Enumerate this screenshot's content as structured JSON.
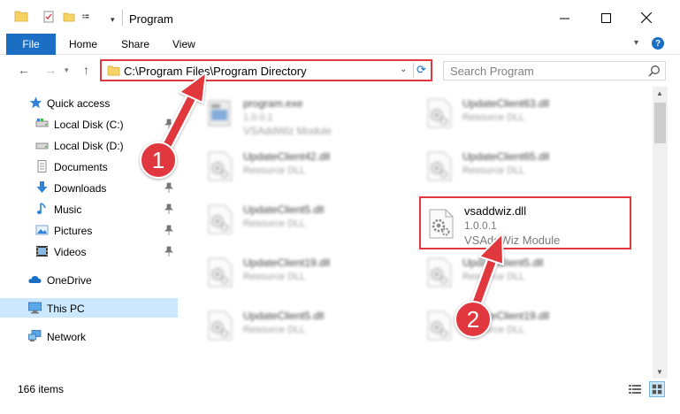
{
  "window": {
    "title": "Program"
  },
  "ribbon": {
    "tabs": [
      {
        "label": "File"
      },
      {
        "label": "Home"
      },
      {
        "label": "Share"
      },
      {
        "label": "View"
      }
    ],
    "help_label": "?"
  },
  "address": {
    "path": "C:\\Program Files\\Program Directory",
    "search_placeholder": "Search Program"
  },
  "sidebar": {
    "items": [
      {
        "label": "Quick access",
        "icon": "star-icon",
        "pinned": false
      },
      {
        "label": "Local Disk (C:)",
        "icon": "drive-icon",
        "pinned": true
      },
      {
        "label": "Local Disk (D:)",
        "icon": "drive-icon",
        "pinned": true
      },
      {
        "label": "Documents",
        "icon": "documents-icon",
        "pinned": true
      },
      {
        "label": "Downloads",
        "icon": "download-icon",
        "pinned": true
      },
      {
        "label": "Music",
        "icon": "music-icon",
        "pinned": true
      },
      {
        "label": "Pictures",
        "icon": "pictures-icon",
        "pinned": true
      },
      {
        "label": "Videos",
        "icon": "videos-icon",
        "pinned": true
      },
      {
        "label": "OneDrive",
        "icon": "cloud-icon",
        "pinned": false
      },
      {
        "label": "This PC",
        "icon": "computer-icon",
        "pinned": false,
        "selected": true
      },
      {
        "label": "Network",
        "icon": "network-icon",
        "pinned": false
      }
    ]
  },
  "files": [
    {
      "name": "program.exe",
      "line2": "1.0.0.1",
      "line3": "VSAddWiz Module",
      "icon": "exe-icon"
    },
    {
      "name": "UpdateClient63.dll",
      "line2": "Resource DLL",
      "line3": "",
      "icon": "dll-gear-icon"
    },
    {
      "name": "UpdateClient42.dll",
      "line2": "Resource DLL",
      "line3": "",
      "icon": "dll-gear-icon"
    },
    {
      "name": "UpdateClient65.dll",
      "line2": "Resource DLL",
      "line3": "",
      "icon": "dll-gear-icon"
    },
    {
      "name": "UpdateClient5.dll",
      "line2": "Resource DLL",
      "line3": "",
      "icon": "dll-gear-icon"
    },
    {
      "name": "vsaddwiz.dll",
      "line2": "1.0.0.1",
      "line3": "VSAddWiz Module",
      "icon": "dll-gear-icon",
      "highlighted": true
    },
    {
      "name": "UpdateClient19.dll",
      "line2": "Resource DLL",
      "line3": "",
      "icon": "dll-gear-icon"
    },
    {
      "name": "UpdateClient5.dll",
      "line2": "Resource DLL",
      "line3": "",
      "icon": "dll-gear-icon"
    },
    {
      "name": "UpdateClient5.dll",
      "line2": "Resource DLL",
      "line3": "",
      "icon": "dll-gear-icon"
    },
    {
      "name": "UpdateClient19.dll",
      "line2": "Resource DLL",
      "line3": "",
      "icon": "dll-gear-icon"
    }
  ],
  "status": {
    "count": "166 items"
  },
  "annotations": {
    "step1": "1",
    "step2": "2",
    "color": "#e0383e"
  },
  "colors": {
    "accent": "#1a6fc4",
    "selection": "#cce8ff",
    "highlight": "#e0383e"
  }
}
